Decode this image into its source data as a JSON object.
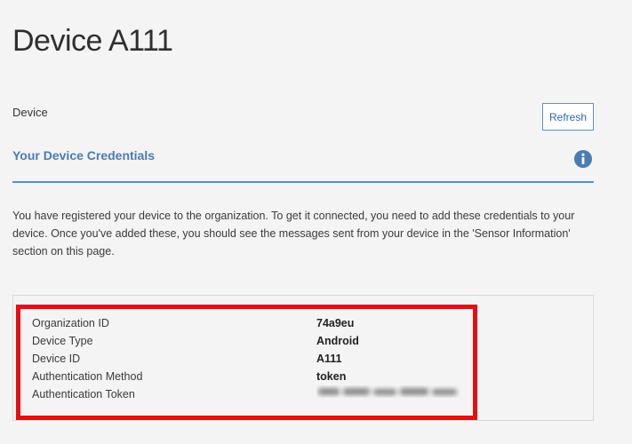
{
  "page": {
    "title": "Device A111"
  },
  "device_section": {
    "label": "Device",
    "refresh_label": "Refresh"
  },
  "credentials": {
    "heading": "Your Device Credentials",
    "info_icon": "info-icon",
    "description": "You have registered your device to the organization. To get it connected, you need to add these credentials to your device. Once you've added these, you should see the messages sent from your device in the 'Sensor Information' section on this page.",
    "rows": [
      {
        "label": "Organization ID",
        "value": "74a9eu"
      },
      {
        "label": "Device Type",
        "value": "Android"
      },
      {
        "label": "Device ID",
        "value": "A111"
      },
      {
        "label": "Authentication Method",
        "value": "token"
      },
      {
        "label": "Authentication Token",
        "value": ""
      }
    ]
  },
  "colors": {
    "accent": "#5a90c2",
    "heading": "#4a7bb3",
    "highlight": "#e40e14",
    "background": "#f4f4f4"
  }
}
